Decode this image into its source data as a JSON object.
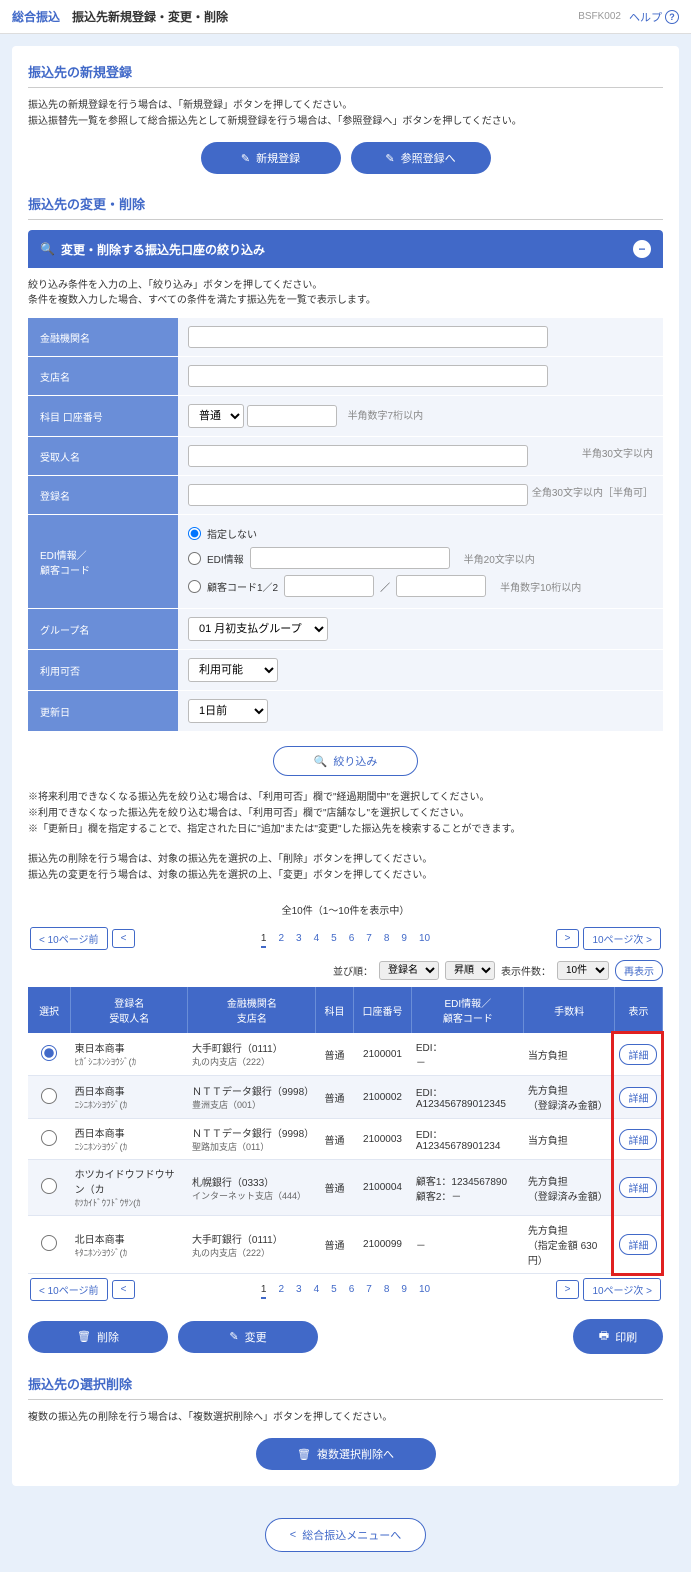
{
  "header": {
    "category": "総合振込",
    "title": "振込先新規登録・変更・削除",
    "code": "BSFK002",
    "help": "ヘルプ"
  },
  "section_register": {
    "title": "振込先の新規登録",
    "desc1": "振込先の新規登録を行う場合は、「新規登録」ボタンを押してください。",
    "desc2": "振込振替先一覧を参照して総合振込先として新規登録を行う場合は、「参照登録へ」ボタンを押してください。",
    "btn_new": "新規登録",
    "btn_ref": "参照登録へ"
  },
  "section_edit": {
    "title": "振込先の変更・削除"
  },
  "filter": {
    "accordion_title": "変更・削除する振込先口座の絞り込み",
    "desc1": "絞り込み条件を入力の上、「絞り込み」ボタンを押してください。",
    "desc2": "条件を複数入力した場合、すべての条件を満たす振込先を一覧で表示します。",
    "lbl_bank": "金融機関名",
    "lbl_branch": "支店名",
    "lbl_acct": "科目 口座番号",
    "lbl_payee": "受取人名",
    "lbl_regname": "登録名",
    "lbl_edi": "EDI情報／\n顧客コード",
    "lbl_group": "グループ名",
    "lbl_avail": "利用可否",
    "lbl_updated": "更新日",
    "acct_type": "普通",
    "acct_hint": "半角数字7桁以内",
    "payee_hint": "半角30文字以内",
    "regname_hint": "全角30文字以内［半角可］",
    "edi_r1": "指定しない",
    "edi_r2": "EDI情報",
    "edi_r2_hint": "半角20文字以内",
    "edi_r3": "顧客コード1／2",
    "edi_r3_sep": "／",
    "edi_r3_hint": "半角数字10桁以内",
    "group_sel": "01 月初支払グループ",
    "avail_sel": "利用可能",
    "updated_sel": "1日前",
    "btn_filter": "絞り込み",
    "note1": "※将来利用できなくなる振込先を絞り込む場合は、「利用可否」欄で\"経過期間中\"を選択してください。",
    "note2": "※利用できなくなった振込先を絞り込む場合は、「利用可否」欄で\"店舗なし\"を選択してください。",
    "note3": "※「更新日」欄を指定することで、指定された日に\"追加\"または\"変更\"した振込先を検索することができます。"
  },
  "list_desc": {
    "d1": "振込先の削除を行う場合は、対象の振込先を選択の上、「削除」ボタンを押してください。",
    "d2": "振込先の変更を行う場合は、対象の振込先を選択の上、「変更」ボタンを押してください。"
  },
  "pager": {
    "info": "全10件（1～10件を表示中）",
    "prev_chunk": "10ページ前",
    "next_chunk": "10ページ次",
    "pages": [
      "1",
      "2",
      "3",
      "4",
      "5",
      "6",
      "7",
      "8",
      "9",
      "10"
    ],
    "current": "1"
  },
  "sort": {
    "lbl_order": "並び順：",
    "field": "登録名",
    "dir": "昇順",
    "lbl_count": "表示件数：",
    "count": "10件",
    "btn": "再表示"
  },
  "table": {
    "h_sel": "選択",
    "h_name": "登録名\n受取人名",
    "h_bank": "金融機関名\n支店名",
    "h_type": "科目",
    "h_acct": "口座番号",
    "h_edi": "EDI情報／\n顧客コード",
    "h_fee": "手数料",
    "h_disp": "表示",
    "btn_detail": "詳細"
  },
  "rows": [
    {
      "sel": true,
      "name": "東日本商事",
      "kana": "ﾋｶﾞｼﾆﾎﾝｼﾖｳｼﾞ(ｶ",
      "bank": "大手町銀行（0111）",
      "branch": "丸の内支店（222）",
      "type": "普通",
      "acct": "2100001",
      "edi": "EDI：\n－",
      "fee": "当方負担"
    },
    {
      "sel": false,
      "name": "西日本商事",
      "kana": "ﾆｼﾆﾎﾝｼﾖｳｼﾞ(ｶ",
      "bank": "ＮＴＴデータ銀行（9998）",
      "branch": "豊洲支店（001）",
      "type": "普通",
      "acct": "2100002",
      "edi": "EDI：\nA123456789012345",
      "fee": "先方負担\n（登録済み金額）"
    },
    {
      "sel": false,
      "name": "西日本商事",
      "kana": "ﾆｼﾆﾎﾝｼﾖｳｼﾞ(ｶ",
      "bank": "ＮＴＴデータ銀行（9998）",
      "branch": "聖路加支店（011）",
      "type": "普通",
      "acct": "2100003",
      "edi": "EDI：\nA12345678901234",
      "fee": "当方負担"
    },
    {
      "sel": false,
      "name": "ホツカイドウフドウサン（カ",
      "kana": "ﾎﾂｶｲﾄﾞｳﾌﾄﾞｳｻﾝ(ｶ",
      "bank": "札幌銀行（0333）",
      "branch": "インターネット支店（444）",
      "type": "普通",
      "acct": "2100004",
      "edi": "顧客1：1234567890\n顧客2：－",
      "fee": "先方負担\n（登録済み金額）"
    },
    {
      "sel": false,
      "name": "北日本商事",
      "kana": "ｷﾀﾆﾎﾝｼﾖｳｼﾞ(ｶ",
      "bank": "大手町銀行（0111）",
      "branch": "丸の内支店（222）",
      "type": "普通",
      "acct": "2100099",
      "edi": "－",
      "fee": "先方負担\n（指定金額 630円）"
    }
  ],
  "actions": {
    "delete": "削除",
    "change": "変更",
    "print": "印刷"
  },
  "section_multi": {
    "title": "振込先の選択削除",
    "desc": "複数の振込先の削除を行う場合は、「複数選択削除へ」ボタンを押してください。",
    "btn": "複数選択削除へ"
  },
  "back_btn": "総合振込メニューへ"
}
